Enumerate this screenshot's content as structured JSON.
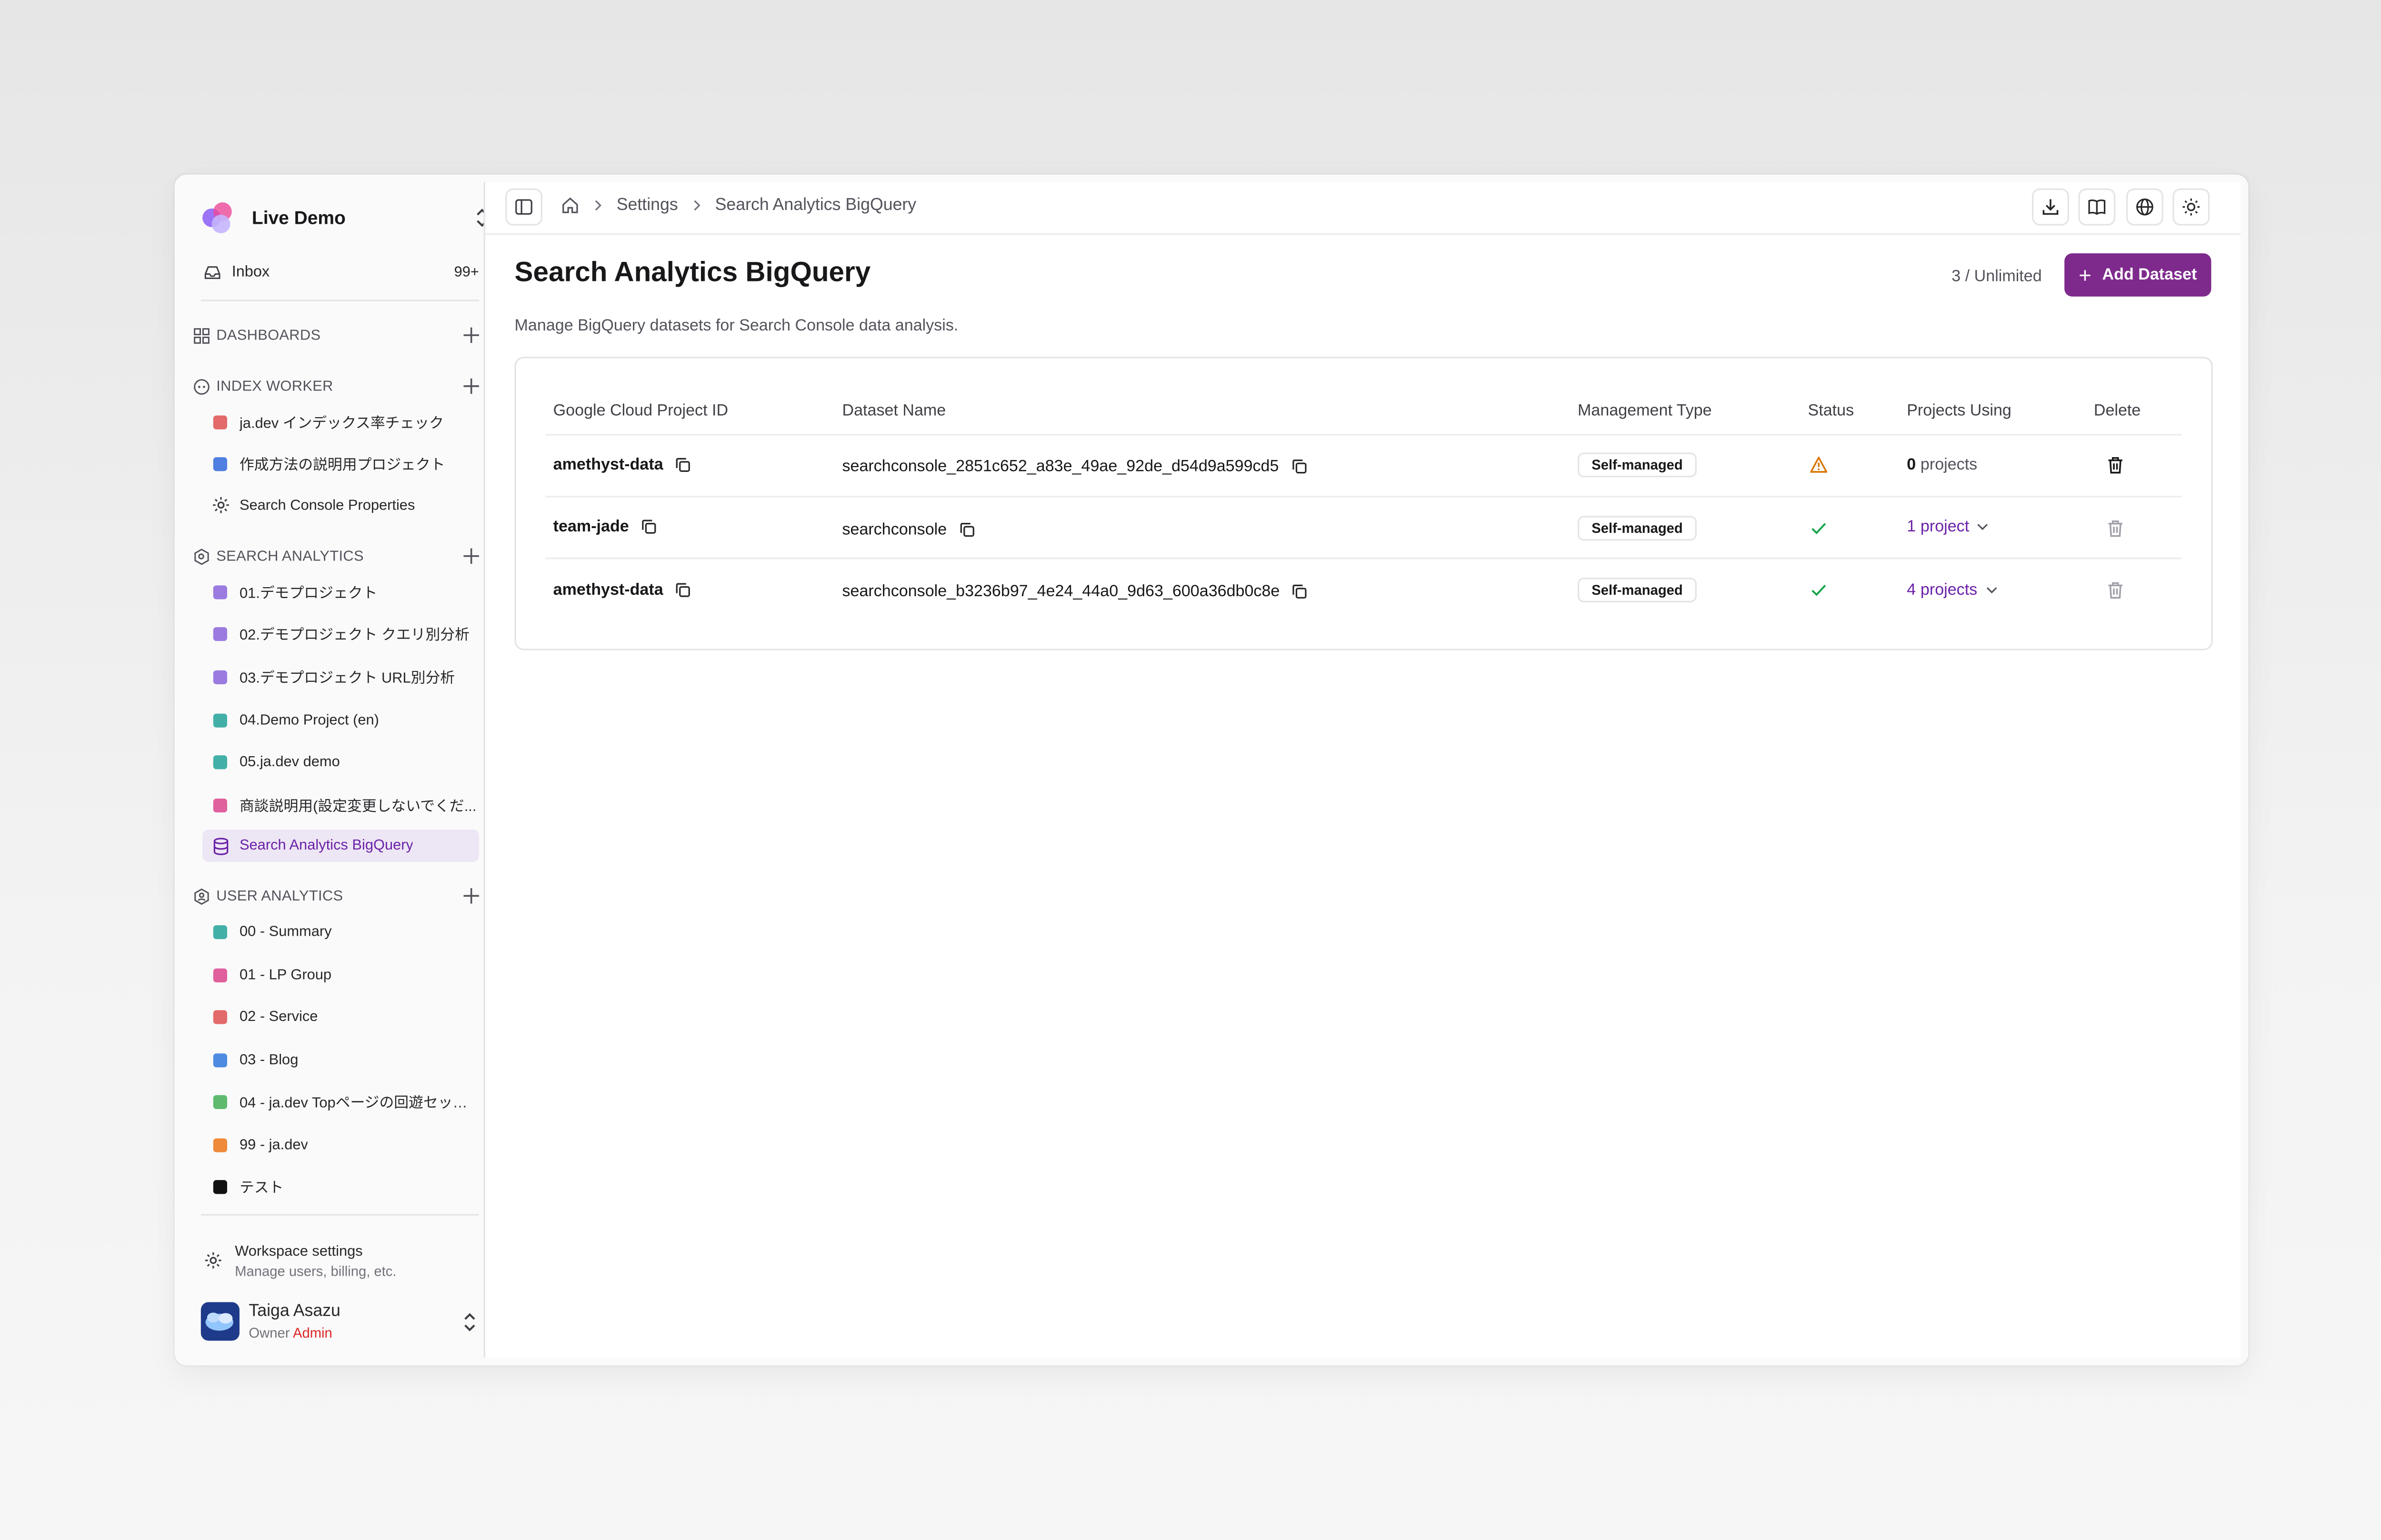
{
  "workspace": {
    "name": "Live Demo"
  },
  "inbox": {
    "label": "Inbox",
    "count": "99+"
  },
  "sections": {
    "dashboards": "DASHBOARDS",
    "index_worker": "INDEX WORKER",
    "search_analytics": "SEARCH ANALYTICS",
    "user_analytics": "USER ANALYTICS"
  },
  "index_worker_items": [
    {
      "label": "ja.dev インデックス率チェック",
      "color": "#e36a6a"
    },
    {
      "label": "作成方法の説明用プロジェクト",
      "color": "#4f7fe0"
    },
    {
      "label": "Search Console Properties",
      "icon": "gear-icon"
    }
  ],
  "search_analytics_items": [
    {
      "label": "01.デモプロジェクト",
      "color": "#9b7be0"
    },
    {
      "label": "02.デモプロジェクト クエリ別分析",
      "color": "#9b7be0"
    },
    {
      "label": "03.デモプロジェクト URL別分析",
      "color": "#9b7be0"
    },
    {
      "label": "04.Demo Project (en)",
      "color": "#43b0a8"
    },
    {
      "label": "05.ja.dev demo",
      "color": "#43b0a8"
    },
    {
      "label": "商談説明用(設定変更しないでくだ...",
      "color": "#e0609e"
    },
    {
      "label": "Search Analytics BigQuery",
      "icon": "database-icon",
      "active": true
    }
  ],
  "user_analytics_items": [
    {
      "label": "00 - Summary",
      "color": "#43b0a8"
    },
    {
      "label": "01 - LP Group",
      "color": "#e0609e"
    },
    {
      "label": "02 - Service",
      "color": "#e36a6a"
    },
    {
      "label": "03 - Blog",
      "color": "#4f8be0"
    },
    {
      "label": "04 - ja.dev Topページの回遊セッシ...",
      "color": "#5fba6e"
    },
    {
      "label": "99 - ja.dev",
      "color": "#ef8a3a"
    },
    {
      "label": "テスト",
      "color": "#111111"
    }
  ],
  "workspace_settings": {
    "title": "Workspace settings",
    "subtitle": "Manage users, billing, etc."
  },
  "user": {
    "name": "Taiga Asazu",
    "role": "Owner",
    "badge": "Admin"
  },
  "breadcrumb": {
    "settings": "Settings",
    "current": "Search Analytics BigQuery"
  },
  "page": {
    "title": "Search Analytics BigQuery",
    "description": "Manage BigQuery datasets for Search Console data analysis.",
    "quota": "3 / Unlimited",
    "add_button": "Add Dataset"
  },
  "table": {
    "headers": {
      "project_id": "Google Cloud Project ID",
      "dataset": "Dataset Name",
      "management": "Management Type",
      "status": "Status",
      "projects_using": "Projects Using",
      "delete": "Delete"
    },
    "rows": [
      {
        "project_id": "amethyst-data",
        "dataset": "searchconsole_2851c652_a83e_49ae_92de_d54d9a599cd5",
        "management": "Self-managed",
        "status": "warning",
        "projects_count": "0",
        "projects_word": "projects",
        "expandable": false,
        "delete_enabled": true
      },
      {
        "project_id": "team-jade",
        "dataset": "searchconsole",
        "management": "Self-managed",
        "status": "ok",
        "projects_count": "1",
        "projects_word": "project",
        "expandable": true,
        "delete_enabled": false
      },
      {
        "project_id": "amethyst-data",
        "dataset": "searchconsole_b3236b97_4e24_44a0_9d63_600a36db0c8e",
        "management": "Self-managed",
        "status": "ok",
        "projects_count": "4",
        "projects_word": "projects",
        "expandable": true,
        "delete_enabled": false
      }
    ]
  },
  "colors": {
    "accent": "#7e2a8c",
    "warning": "#d97706",
    "ok": "#16a34a",
    "admin": "#dc2626"
  }
}
